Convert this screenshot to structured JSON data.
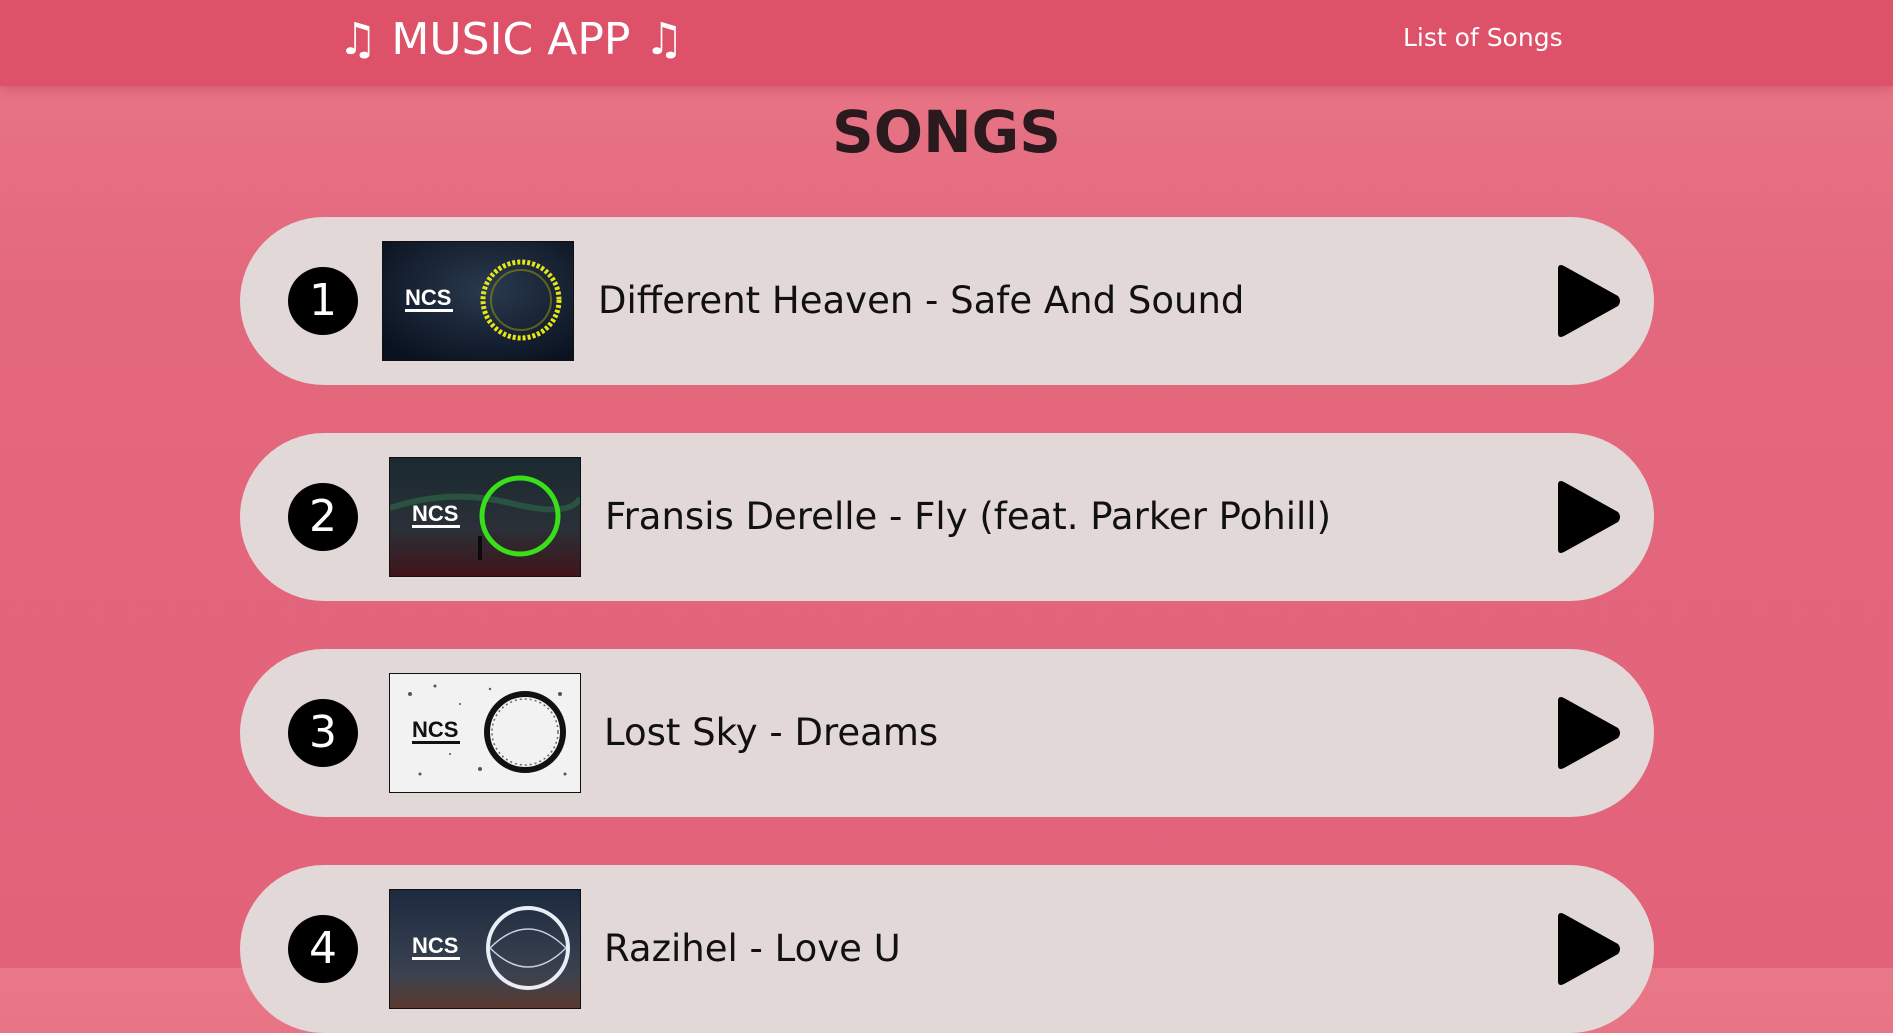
{
  "header": {
    "brand": "♫ MUSIC APP ♫",
    "nav_link": "List of Songs"
  },
  "page": {
    "title": "SONGS"
  },
  "songs": [
    {
      "number": "1",
      "title": "Different Heaven - Safe And Sound",
      "cover_logo": "NCS",
      "cover_ring_color": "#e4e616"
    },
    {
      "number": "2",
      "title": "Fransis Derelle - Fly (feat. Parker Pohill)",
      "cover_logo": "NCS",
      "cover_ring_color": "#39e01a"
    },
    {
      "number": "3",
      "title": "Lost Sky - Dreams",
      "cover_logo": "NCS",
      "cover_ring_color": "#111111"
    },
    {
      "number": "4",
      "title": "Razihel - Love U",
      "cover_logo": "NCS",
      "cover_ring_color": "#e8eef5"
    }
  ],
  "colors": {
    "navbar": "#dd5169",
    "background": "#e4687d",
    "card": "#e2d8d7",
    "badge": "#000000"
  }
}
